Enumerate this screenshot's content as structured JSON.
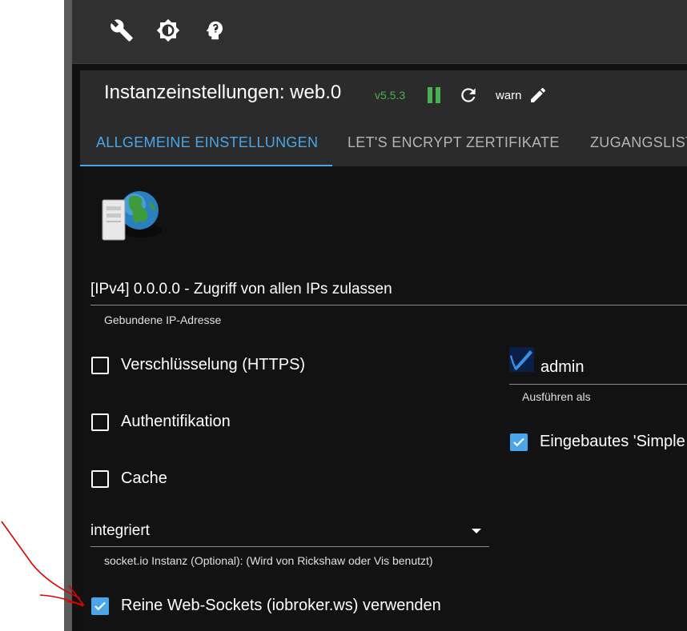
{
  "toolbar": {
    "icons": [
      "wrench-icon",
      "brightness-icon",
      "expert-mode-icon"
    ]
  },
  "dialog": {
    "title": "Instanzeinstellungen: web.0",
    "version": "v5.5.3",
    "status_color": "#4caf50",
    "log_level": "warn"
  },
  "tabs": [
    {
      "label": "ALLGEMEINE EINSTELLUNGEN",
      "active": true
    },
    {
      "label": "LET'S ENCRYPT ZERTIFIKATE",
      "active": false
    },
    {
      "label": "ZUGANGSLIST",
      "active": false
    }
  ],
  "form": {
    "bind_ip": {
      "value": "[IPv4] 0.0.0.0 - Zugriff von allen IPs zulassen",
      "helper": "Gebundene IP-Adresse"
    },
    "https": {
      "label": "Verschlüsselung (HTTPS)",
      "checked": false
    },
    "auth": {
      "label": "Authentifikation",
      "checked": false
    },
    "cache": {
      "label": "Cache",
      "checked": false
    },
    "socketio": {
      "value": "integriert",
      "helper": "socket.io Instanz (Optional): (Wird von Rickshaw oder Vis benutzt)"
    },
    "pure_websockets": {
      "label": "Reine Web-Sockets (iobroker.ws) verwenden",
      "checked": true
    },
    "run_as": {
      "value": "admin",
      "helper": "Ausführen als"
    },
    "simple_api": {
      "label": "Eingebautes 'Simple",
      "checked": true
    }
  },
  "colors": {
    "accent": "#4aa6e8",
    "background": "#121212",
    "header": "#2b2b2b",
    "annotation": "#e00000"
  }
}
